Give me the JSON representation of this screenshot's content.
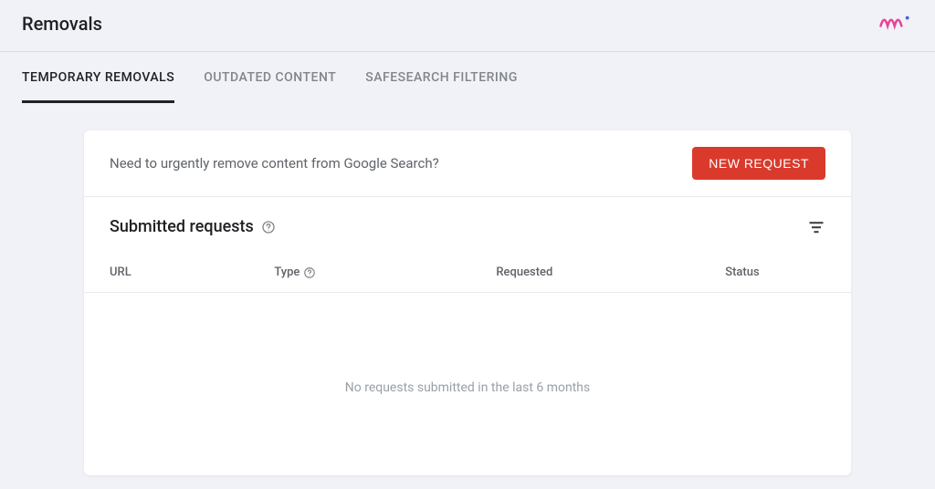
{
  "header": {
    "title": "Removals"
  },
  "tabs": {
    "items": [
      {
        "label": "TEMPORARY REMOVALS",
        "active": true
      },
      {
        "label": "OUTDATED CONTENT",
        "active": false
      },
      {
        "label": "SAFESEARCH FILTERING",
        "active": false
      }
    ]
  },
  "card": {
    "prompt": "Need to urgently remove content from Google Search?",
    "new_request_label": "NEW REQUEST",
    "requests_title": "Submitted requests",
    "columns": {
      "url": "URL",
      "type": "Type",
      "requested": "Requested",
      "status": "Status"
    },
    "empty_message": "No requests submitted in the last 6 months"
  }
}
